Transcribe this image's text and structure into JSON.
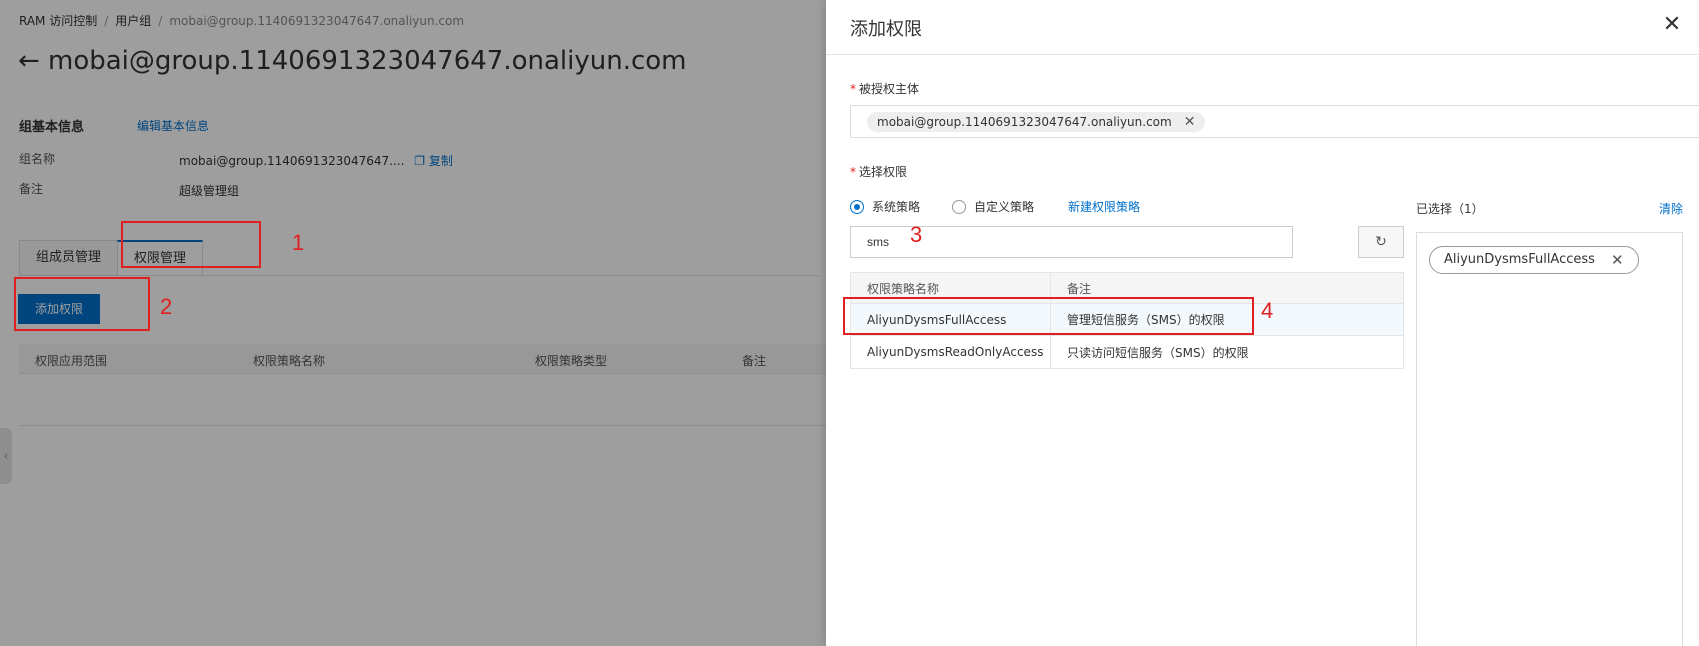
{
  "page": {
    "breadcrumb": [
      "RAM 访问控制",
      "用户组",
      "mobai@group.1140691323047647.onaliyun.com"
    ],
    "title": "mobai@group.1140691323047647.onaliyun.com",
    "basic_info_title": "组基本信息",
    "edit_link": "编辑基本信息",
    "group_name_label": "组名称",
    "group_name_value": "mobai@group.1140691323047647....",
    "copy_label": "复制",
    "remark_label": "备注",
    "remark_value": "超级管理组",
    "tabs": [
      "组成员管理",
      "权限管理"
    ],
    "add_button": "添加权限",
    "table_headers": [
      "权限应用范围",
      "权限策略名称",
      "权限策略类型",
      "备注"
    ]
  },
  "annotations": [
    "1",
    "2",
    "3",
    "4"
  ],
  "drawer": {
    "title": "添加权限",
    "principal_label": "被授权主体",
    "principal_tag": "mobai@group.1140691323047647.onaliyun.com",
    "select_label": "选择权限",
    "radio_system": "系统策略",
    "radio_custom": "自定义策略",
    "new_policy": "新建权限策略",
    "search_value": "sms",
    "table_headers": [
      "权限策略名称",
      "备注"
    ],
    "rows": [
      {
        "name": "AliyunDysmsFullAccess",
        "note": "管理短信服务（SMS）的权限"
      },
      {
        "name": "AliyunDysmsReadOnlyAccess",
        "note": "只读访问短信服务（SMS）的权限"
      }
    ],
    "selected_title": "已选择（1）",
    "clear_label": "清除",
    "selected_tag": "AliyunDysmsFullAccess"
  },
  "colors": {
    "accent": "#0070cc",
    "annotation": "#e02020"
  }
}
